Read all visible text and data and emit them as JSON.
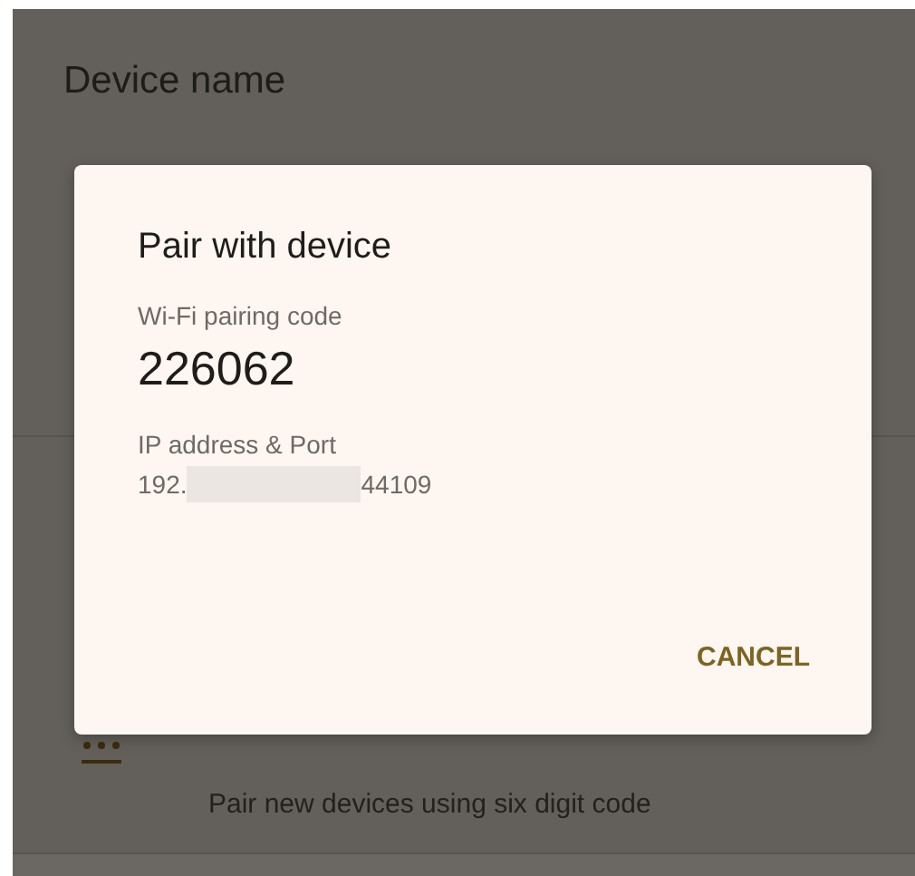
{
  "background": {
    "device_name": {
      "title": "Device name"
    },
    "pair_code_item": {
      "subtitle": "Pair new devices using six digit code"
    }
  },
  "dialog": {
    "title": "Pair with device",
    "code_label": "Wi-Fi pairing code",
    "code": "226062",
    "address_label": "IP address & Port",
    "address_start": "192.",
    "address_end": "44109",
    "buttons": [
      "CANCEL"
    ]
  }
}
